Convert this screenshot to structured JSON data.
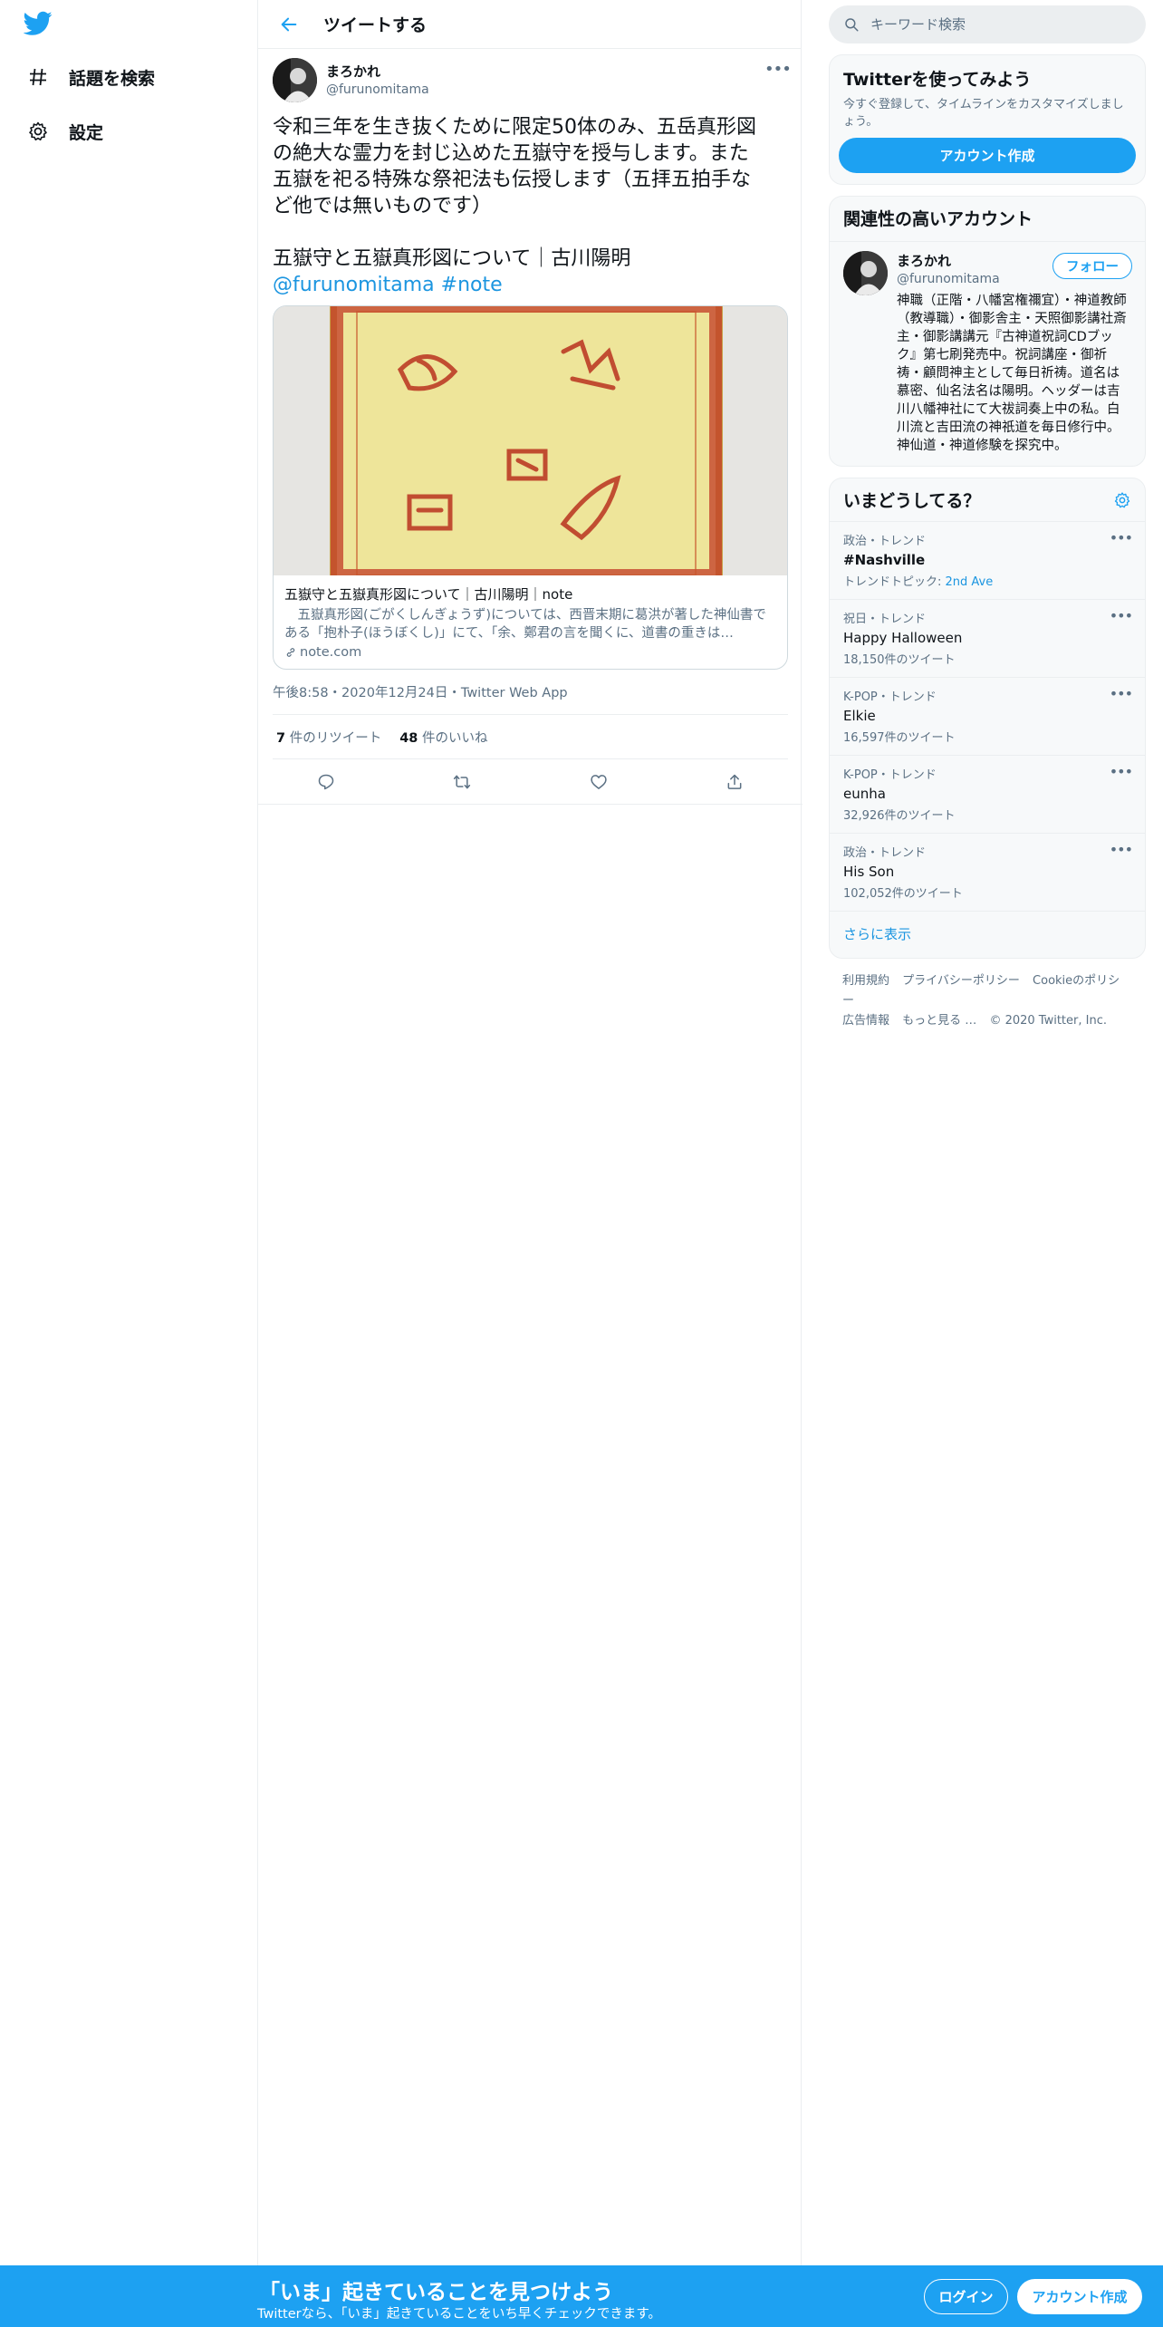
{
  "nav": {
    "logo": "twitter-bird-icon",
    "items": [
      {
        "label": "話題を検索",
        "icon": "hashtag-icon"
      },
      {
        "label": "設定",
        "icon": "gear-icon"
      }
    ]
  },
  "header": {
    "title": "ツイートする"
  },
  "tweet": {
    "display_name": "まろかれ",
    "handle": "@furunomitama",
    "text_lines": [
      "令和三年を生き抜くために限定50体のみ、五岳真形図",
      "の絶大な霊力を封じ込めた五嶽守を授与します。また",
      "五嶽を祀る特殊な祭祀法も伝授します（五拝五拍手な",
      "ど他では無いものです）"
    ],
    "article_line": "五嶽守と五嶽真形図について｜古川陽明",
    "mention": "@furunomitama",
    "hashtag": "#note",
    "card": {
      "title": "五嶽守と五嶽真形図について｜古川陽明｜note",
      "description": "　五嶽真形図(ごがくしんぎょうず)については、西晋末期に葛洪が著した神仙書である「抱朴子(ほうぼくし)」にて、「余、鄭君の言を聞くに、道書の重きは…",
      "domain": "note.com"
    },
    "meta": "午後8:58・2020年12月24日・Twitter Web App",
    "retweets_count": "7",
    "retweets_label": "件のリツイート",
    "likes_count": "48",
    "likes_label": "件のいいね"
  },
  "right": {
    "search_placeholder": "キーワード検索",
    "signup": {
      "title": "Twitterを使ってみよう",
      "desc": "今すぐ登録して、タイムラインをカスタマイズしましょう。",
      "button": "アカウント作成"
    },
    "related": {
      "title": "関連性の高いアカウント",
      "name": "まろかれ",
      "handle": "@furunomitama",
      "follow": "フォロー",
      "bio": "神職（正階・八幡宮権禰宜）・神道教師（教導職）・御影舎主・天照御影講社斎主・御影講講元『古神道祝詞CDブック』第七刷発売中。祝詞講座・御祈祷・顧問神主として毎日祈祷。道名は慕密、仙名法名は陽明。ヘッダーは吉川八幡神社にて大祓詞奏上中の私。白川流と吉田流の神祇道を毎日修行中。神仙道・神道修験を探究中。"
    },
    "trends": {
      "title": "いまどうしてる？",
      "items": [
        {
          "category": "政治・トレンド",
          "name": "#Nashville",
          "sub_prefix": "トレンドトピック: ",
          "sub_link": "2nd Ave",
          "bold": true
        },
        {
          "category": "祝日・トレンド",
          "name": "Happy Halloween",
          "sub": "18,150件のツイート"
        },
        {
          "category": "K-POP・トレンド",
          "name": "Elkie",
          "sub": "16,597件のツイート"
        },
        {
          "category": "K-POP・トレンド",
          "name": "eunha",
          "sub": "32,926件のツイート"
        },
        {
          "category": "政治・トレンド",
          "name": "His Son",
          "sub": "102,052件のツイート"
        }
      ],
      "show_more": "さらに表示"
    },
    "footer": {
      "links": [
        "利用規約",
        "プライバシーポリシー",
        "Cookieのポリシー",
        "広告情報",
        "もっと見る …"
      ],
      "copyright": "© 2020 Twitter, Inc."
    }
  },
  "banner": {
    "title": "「いま」起きていることを見つけよう",
    "sub": "Twitterなら、「いま」起きていることをいち早くチェックできます。",
    "login": "ログイン",
    "signup": "アカウント作成"
  },
  "colors": {
    "accent": "#1da1f2",
    "link": "#1b95e0",
    "muted": "#5b7083"
  }
}
